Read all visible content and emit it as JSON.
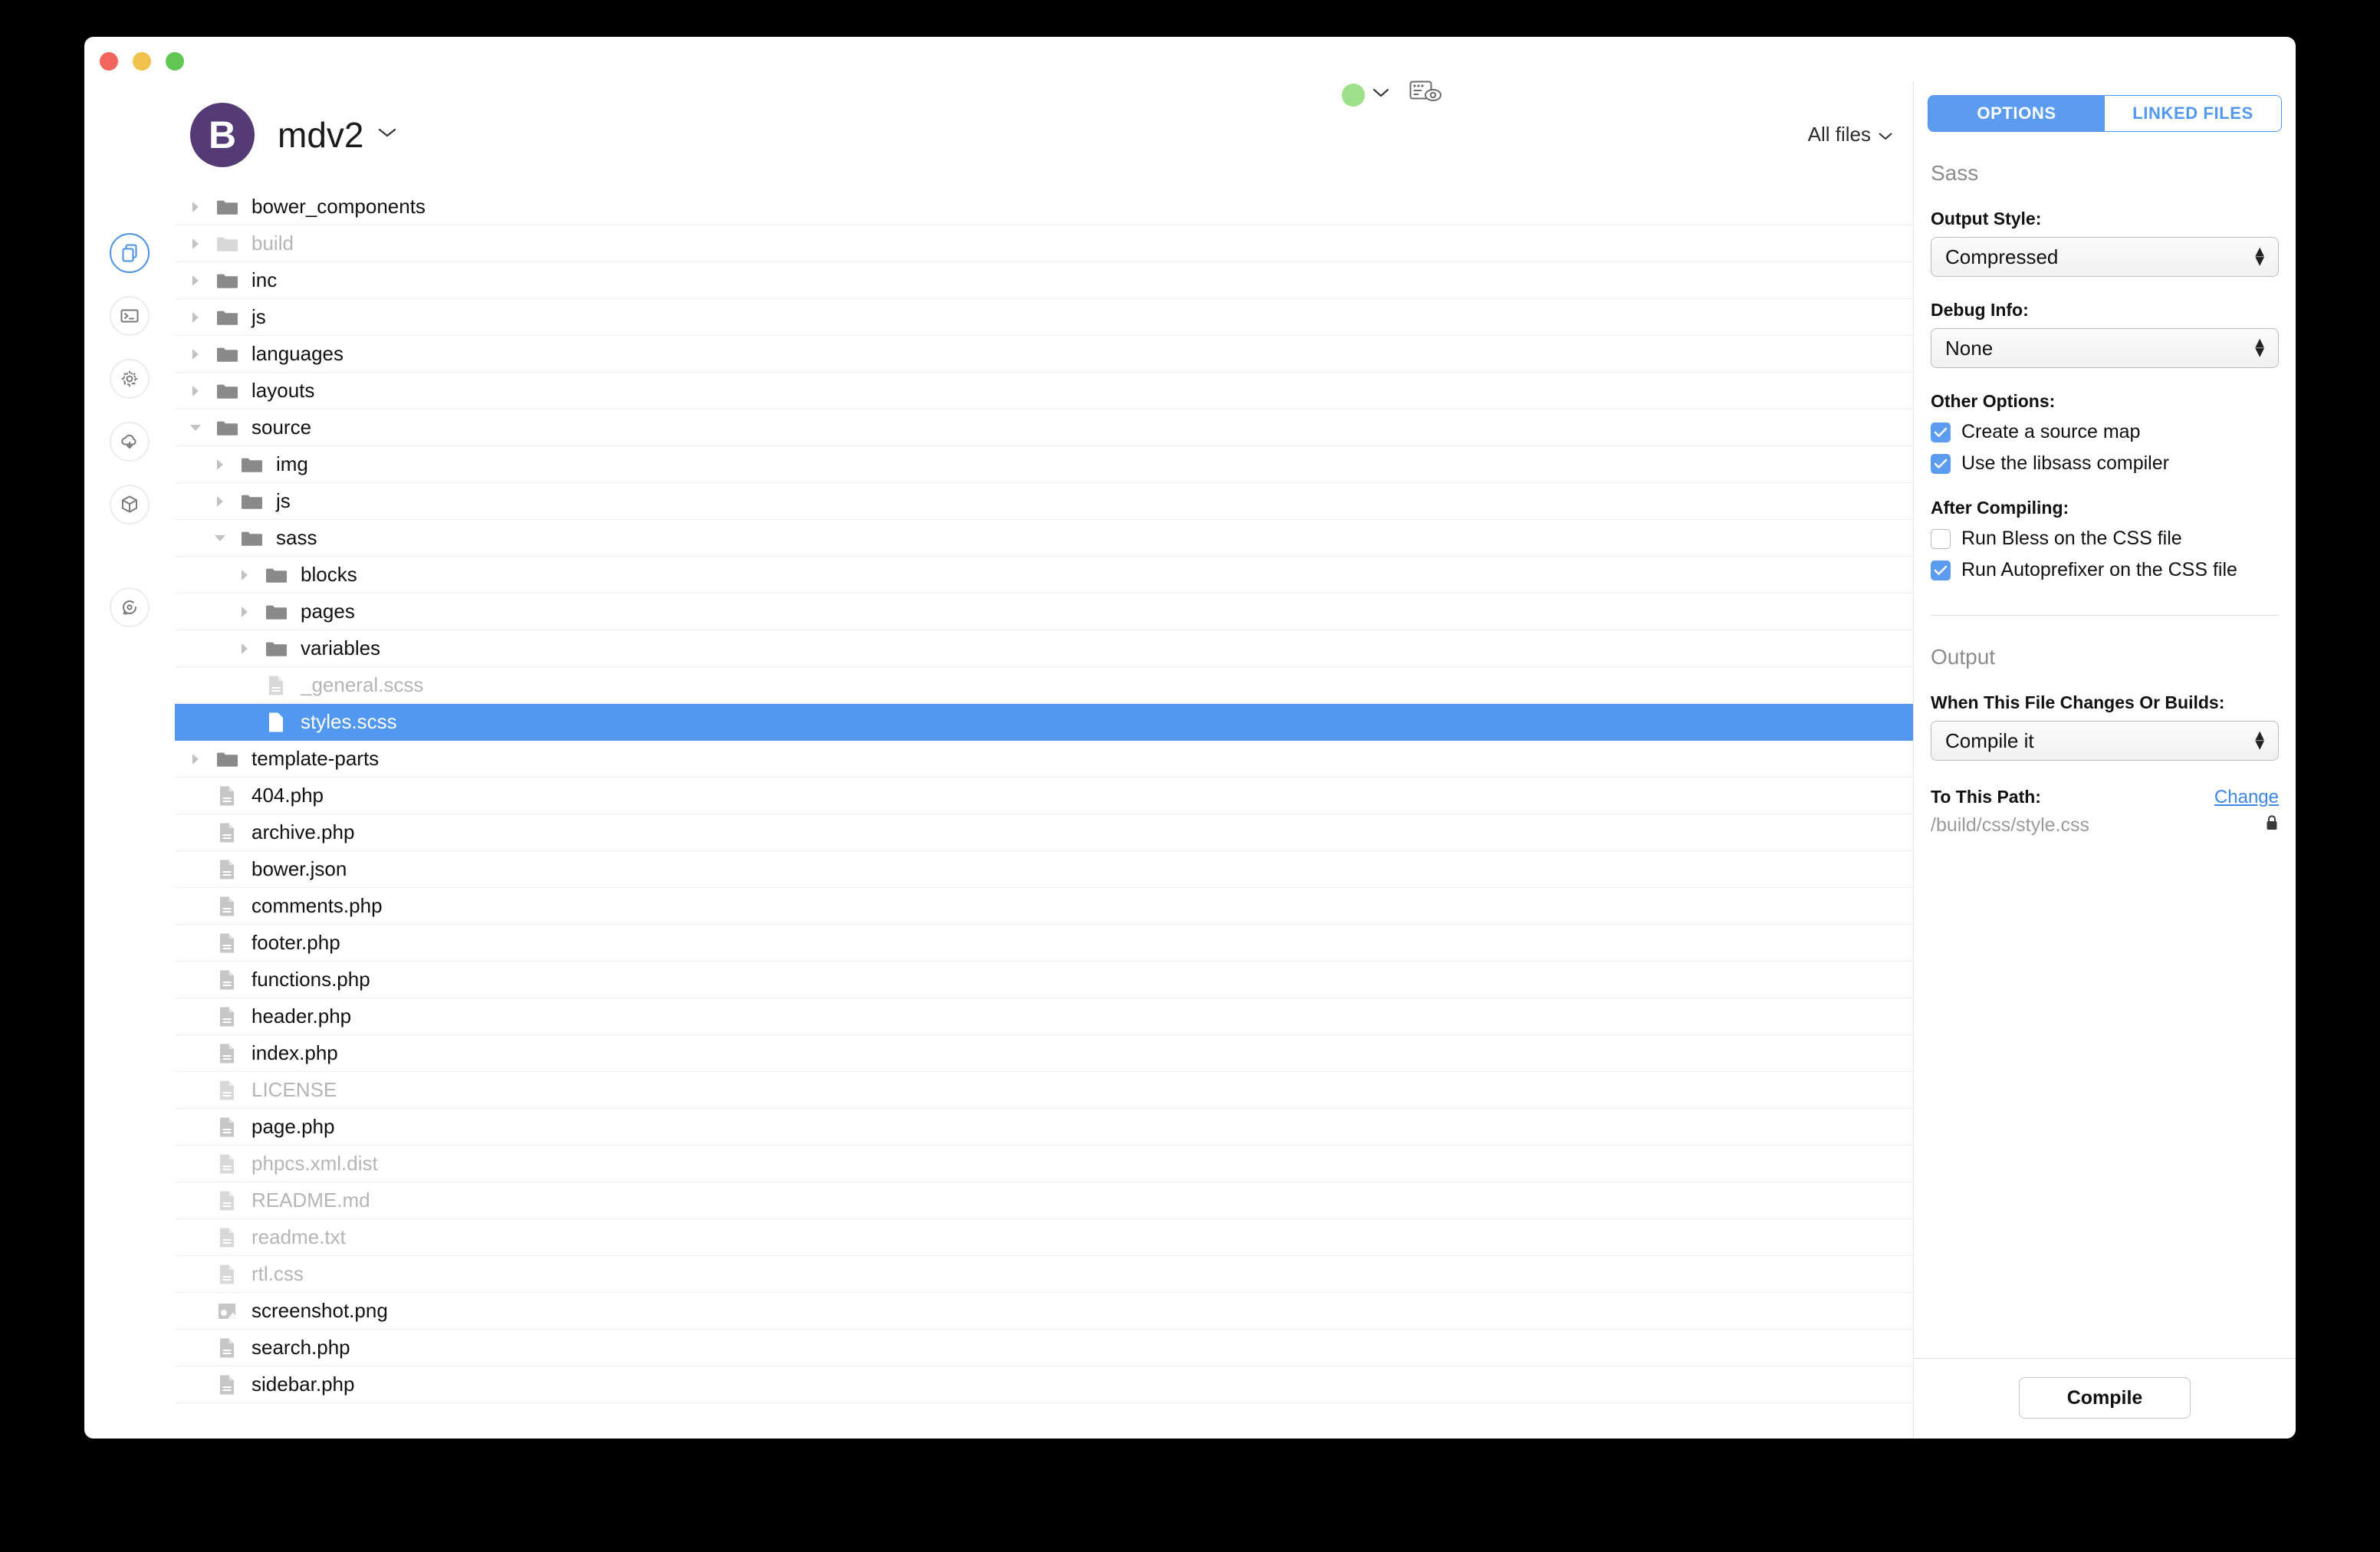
{
  "window": {
    "traffic_lights": [
      "close",
      "minimize",
      "zoom"
    ]
  },
  "header": {
    "avatar_letter": "B",
    "project_name": "mdv2",
    "project_chevron": "chevron-down",
    "filter_label": "All files",
    "filter_chevron": "chevron-down",
    "status_dot_color": "#9de08a",
    "status_chevron": "chevron-down"
  },
  "rail": {
    "items": [
      {
        "name": "files",
        "icon": "files-icon",
        "active": true
      },
      {
        "name": "terminal",
        "icon": "terminal-icon",
        "active": false
      },
      {
        "name": "settings",
        "icon": "gear-icon",
        "active": false
      },
      {
        "name": "hooks",
        "icon": "cloud-download-icon",
        "active": false
      },
      {
        "name": "packages",
        "icon": "cube-icon",
        "active": false
      },
      {
        "name": "history",
        "icon": "history-icon",
        "active": false
      }
    ]
  },
  "files": [
    {
      "label": "bower_components",
      "type": "folder",
      "depth": 0,
      "state": "collapsed",
      "dim": false,
      "selected": false
    },
    {
      "label": "build",
      "type": "folder",
      "depth": 0,
      "state": "collapsed",
      "dim": true,
      "selected": false
    },
    {
      "label": "inc",
      "type": "folder",
      "depth": 0,
      "state": "collapsed",
      "dim": false,
      "selected": false
    },
    {
      "label": "js",
      "type": "folder",
      "depth": 0,
      "state": "collapsed",
      "dim": false,
      "selected": false
    },
    {
      "label": "languages",
      "type": "folder",
      "depth": 0,
      "state": "collapsed",
      "dim": false,
      "selected": false
    },
    {
      "label": "layouts",
      "type": "folder",
      "depth": 0,
      "state": "collapsed",
      "dim": false,
      "selected": false
    },
    {
      "label": "source",
      "type": "folder",
      "depth": 0,
      "state": "expanded",
      "dim": false,
      "selected": false
    },
    {
      "label": "img",
      "type": "folder",
      "depth": 1,
      "state": "collapsed",
      "dim": false,
      "selected": false
    },
    {
      "label": "js",
      "type": "folder",
      "depth": 1,
      "state": "collapsed",
      "dim": false,
      "selected": false
    },
    {
      "label": "sass",
      "type": "folder",
      "depth": 1,
      "state": "expanded",
      "dim": false,
      "selected": false
    },
    {
      "label": "blocks",
      "type": "folder",
      "depth": 2,
      "state": "collapsed",
      "dim": false,
      "selected": false
    },
    {
      "label": "pages",
      "type": "folder",
      "depth": 2,
      "state": "collapsed",
      "dim": false,
      "selected": false
    },
    {
      "label": "variables",
      "type": "folder",
      "depth": 2,
      "state": "collapsed",
      "dim": false,
      "selected": false
    },
    {
      "label": "_general.scss",
      "type": "file",
      "depth": 2,
      "state": "leaf",
      "dim": true,
      "selected": false
    },
    {
      "label": "styles.scss",
      "type": "file",
      "depth": 2,
      "state": "leaf",
      "dim": false,
      "selected": true
    },
    {
      "label": "template-parts",
      "type": "folder",
      "depth": 0,
      "state": "collapsed",
      "dim": false,
      "selected": false
    },
    {
      "label": "404.php",
      "type": "file",
      "depth": 0,
      "state": "leaf",
      "dim": false,
      "selected": false
    },
    {
      "label": "archive.php",
      "type": "file",
      "depth": 0,
      "state": "leaf",
      "dim": false,
      "selected": false
    },
    {
      "label": "bower.json",
      "type": "file",
      "depth": 0,
      "state": "leaf",
      "dim": false,
      "selected": false
    },
    {
      "label": "comments.php",
      "type": "file",
      "depth": 0,
      "state": "leaf",
      "dim": false,
      "selected": false
    },
    {
      "label": "footer.php",
      "type": "file",
      "depth": 0,
      "state": "leaf",
      "dim": false,
      "selected": false
    },
    {
      "label": "functions.php",
      "type": "file",
      "depth": 0,
      "state": "leaf",
      "dim": false,
      "selected": false
    },
    {
      "label": "header.php",
      "type": "file",
      "depth": 0,
      "state": "leaf",
      "dim": false,
      "selected": false
    },
    {
      "label": "index.php",
      "type": "file",
      "depth": 0,
      "state": "leaf",
      "dim": false,
      "selected": false
    },
    {
      "label": "LICENSE",
      "type": "file",
      "depth": 0,
      "state": "leaf",
      "dim": true,
      "selected": false
    },
    {
      "label": "page.php",
      "type": "file",
      "depth": 0,
      "state": "leaf",
      "dim": false,
      "selected": false
    },
    {
      "label": "phpcs.xml.dist",
      "type": "file",
      "depth": 0,
      "state": "leaf",
      "dim": true,
      "selected": false
    },
    {
      "label": "README.md",
      "type": "file",
      "depth": 0,
      "state": "leaf",
      "dim": true,
      "selected": false
    },
    {
      "label": "readme.txt",
      "type": "file",
      "depth": 0,
      "state": "leaf",
      "dim": true,
      "selected": false
    },
    {
      "label": "rtl.css",
      "type": "file",
      "depth": 0,
      "state": "leaf",
      "dim": true,
      "selected": false
    },
    {
      "label": "screenshot.png",
      "type": "image",
      "depth": 0,
      "state": "leaf",
      "dim": false,
      "selected": false
    },
    {
      "label": "search.php",
      "type": "file",
      "depth": 0,
      "state": "leaf",
      "dim": false,
      "selected": false
    },
    {
      "label": "sidebar.php",
      "type": "file",
      "depth": 0,
      "state": "leaf",
      "dim": false,
      "selected": false
    }
  ],
  "inspector": {
    "tabs": [
      {
        "label": "OPTIONS",
        "active": true
      },
      {
        "label": "LINKED FILES",
        "active": false
      }
    ],
    "section_sass": "Sass",
    "output_style_label": "Output Style:",
    "output_style_value": "Compressed",
    "debug_info_label": "Debug Info:",
    "debug_info_value": "None",
    "other_options_label": "Other Options:",
    "other_options": [
      {
        "label": "Create a source map",
        "checked": true
      },
      {
        "label": "Use the libsass compiler",
        "checked": true
      }
    ],
    "after_compiling_label": "After Compiling:",
    "after_compiling": [
      {
        "label": "Run Bless on the CSS file",
        "checked": false
      },
      {
        "label": "Run Autoprefixer on the CSS file",
        "checked": true
      }
    ],
    "section_output": "Output",
    "when_changes_label": "When This File Changes Or Builds:",
    "when_changes_value": "Compile it",
    "to_this_path_label": "To This Path:",
    "change_link": "Change",
    "path_value": "/build/css/style.css",
    "lock_icon": "lock-icon",
    "compile_button": "Compile",
    "accent_color": "#5398f0"
  }
}
